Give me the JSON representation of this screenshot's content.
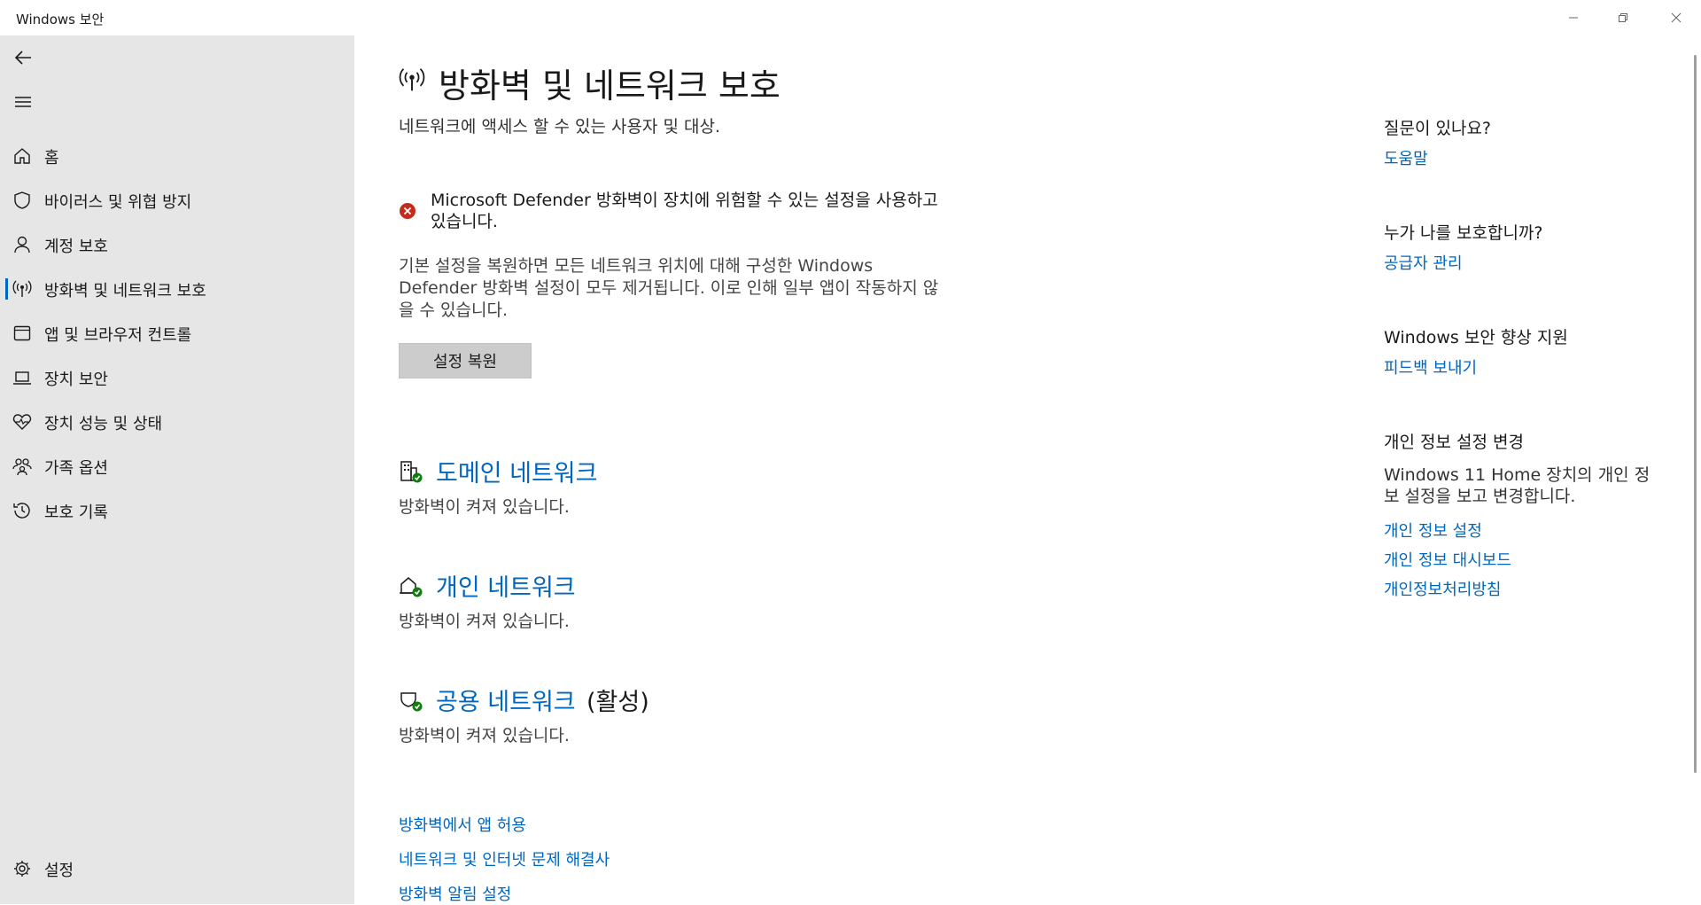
{
  "window": {
    "title": "Windows 보안",
    "controls": [
      "minimize-icon",
      "restore-icon",
      "close-icon"
    ]
  },
  "sidebar": {
    "back_icon": "back-arrow-icon",
    "menu_icon": "hamburger-icon",
    "items": [
      {
        "label": "홈",
        "icon": "home-icon",
        "active": false
      },
      {
        "label": "바이러스 및 위협 방지",
        "icon": "shield-icon",
        "active": false
      },
      {
        "label": "계정 보호",
        "icon": "person-icon",
        "active": false
      },
      {
        "label": "방화벽 및 네트워크 보호",
        "icon": "antenna-icon",
        "active": true
      },
      {
        "label": "앱 및 브라우저 컨트롤",
        "icon": "app-window-icon",
        "active": false
      },
      {
        "label": "장치 보안",
        "icon": "laptop-icon",
        "active": false
      },
      {
        "label": "장치 성능 및 상태",
        "icon": "heart-pulse-icon",
        "active": false
      },
      {
        "label": "가족 옵션",
        "icon": "family-icon",
        "active": false
      },
      {
        "label": "보호 기록",
        "icon": "history-icon",
        "active": false
      }
    ],
    "settings": {
      "label": "설정",
      "icon": "gear-icon"
    }
  },
  "main": {
    "title": "방화벽 및 네트워크 보호",
    "subtitle": "네트워크에 액세스 할 수 있는 사용자 및 대상.",
    "alert": {
      "icon": "error-icon",
      "text": "Microsoft Defender 방화벽이 장치에 위험할 수 있는 설정을 사용하고 있습니다.",
      "description": "기본 설정을 복원하면 모든 네트워크 위치에 대해 구성한 Windows Defender 방화벽 설정이 모두 제거됩니다. 이로 인해 일부 앱이 작동하지 않을 수 있습니다.",
      "button": "설정 복원"
    },
    "networks": [
      {
        "title": "도메인 네트워크",
        "suffix": "",
        "status": "방화벽이 켜져 있습니다.",
        "icon": "domain-network-icon"
      },
      {
        "title": "개인 네트워크",
        "suffix": "",
        "status": "방화벽이 켜져 있습니다.",
        "icon": "private-network-icon"
      },
      {
        "title": "공용 네트워크",
        "suffix": "(활성)",
        "status": "방화벽이 켜져 있습니다.",
        "icon": "public-network-icon"
      }
    ],
    "links": [
      "방화벽에서 앱 허용",
      "네트워크 및 인터넷 문제 해결사",
      "방화벽 알림 설정"
    ]
  },
  "right_panel": {
    "question": {
      "heading": "질문이 있나요?",
      "link": "도움말"
    },
    "protect": {
      "heading": "누가 나를 보호합니까?",
      "link": "공급자 관리"
    },
    "improve": {
      "heading": "Windows 보안 향상 지원",
      "link": "피드백 보내기"
    },
    "privacy": {
      "heading": "개인 정보 설정 변경",
      "text": "Windows 11 Home 장치의 개인 정보 설정을 보고 변경합니다.",
      "links": [
        "개인 정보 설정",
        "개인 정보 대시보드",
        "개인정보처리방침"
      ]
    }
  },
  "colors": {
    "accent": "#0067c0",
    "sidebar_bg": "#e6e6e6",
    "error": "#c42b1c",
    "ok": "#107c10"
  }
}
